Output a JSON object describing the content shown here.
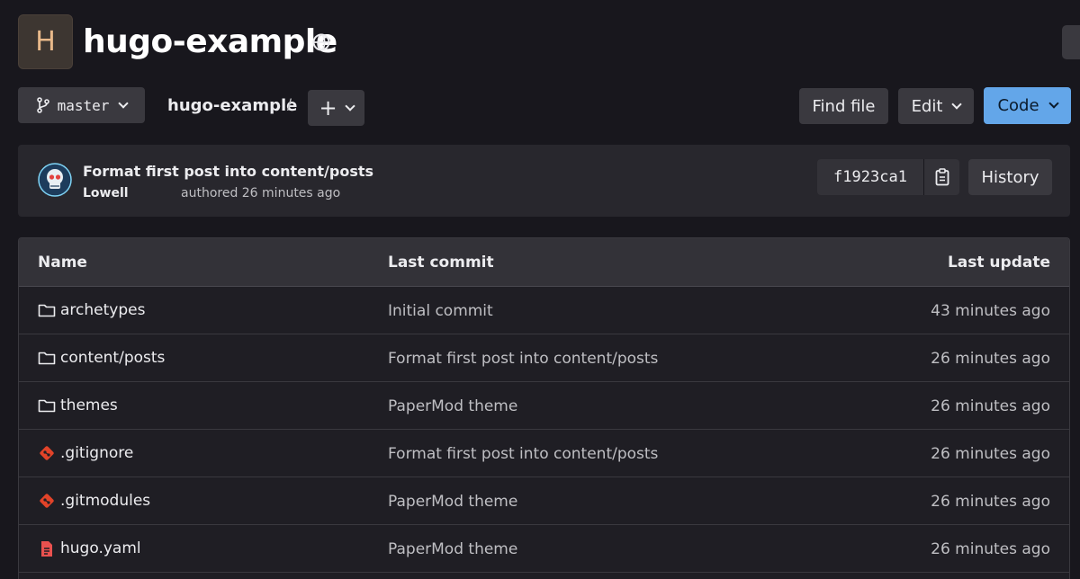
{
  "project": {
    "avatar_letter": "H",
    "name": "hugo-example",
    "visibility_icon": "globe-icon"
  },
  "toolbar": {
    "branch": "master",
    "breadcrumb": "hugo-example",
    "breadcrumb_sep": "/",
    "add_label": "+",
    "find_file": "Find file",
    "edit": "Edit",
    "code": "Code"
  },
  "commit": {
    "title": "Format first post into content/posts",
    "author": "Lowell",
    "time": "authored 26 minutes ago",
    "sha": "f1923ca1",
    "history": "History"
  },
  "table": {
    "headers": {
      "name": "Name",
      "last_commit": "Last commit",
      "last_update": "Last update"
    },
    "rows": [
      {
        "name": "archetypes",
        "icon": "folder-icon",
        "commit": "Initial commit",
        "updated": "43 minutes ago"
      },
      {
        "name": "content/posts",
        "icon": "folder-icon",
        "commit": "Format first post into content/posts",
        "updated": "26 minutes ago"
      },
      {
        "name": "themes",
        "icon": "folder-icon",
        "commit": "PaperMod theme",
        "updated": "26 minutes ago"
      },
      {
        "name": ".gitignore",
        "icon": "git-icon",
        "commit": "Format first post into content/posts",
        "updated": "26 minutes ago"
      },
      {
        "name": ".gitmodules",
        "icon": "git-icon",
        "commit": "PaperMod theme",
        "updated": "26 minutes ago"
      },
      {
        "name": "hugo.yaml",
        "icon": "yaml-file-icon",
        "commit": "PaperMod theme",
        "updated": "26 minutes ago"
      }
    ]
  },
  "colors": {
    "background": "#18171d",
    "button": "#3a393f",
    "primary": "#63a6e9",
    "git_icon": "#e24329",
    "yaml_icon": "#e9514f"
  }
}
